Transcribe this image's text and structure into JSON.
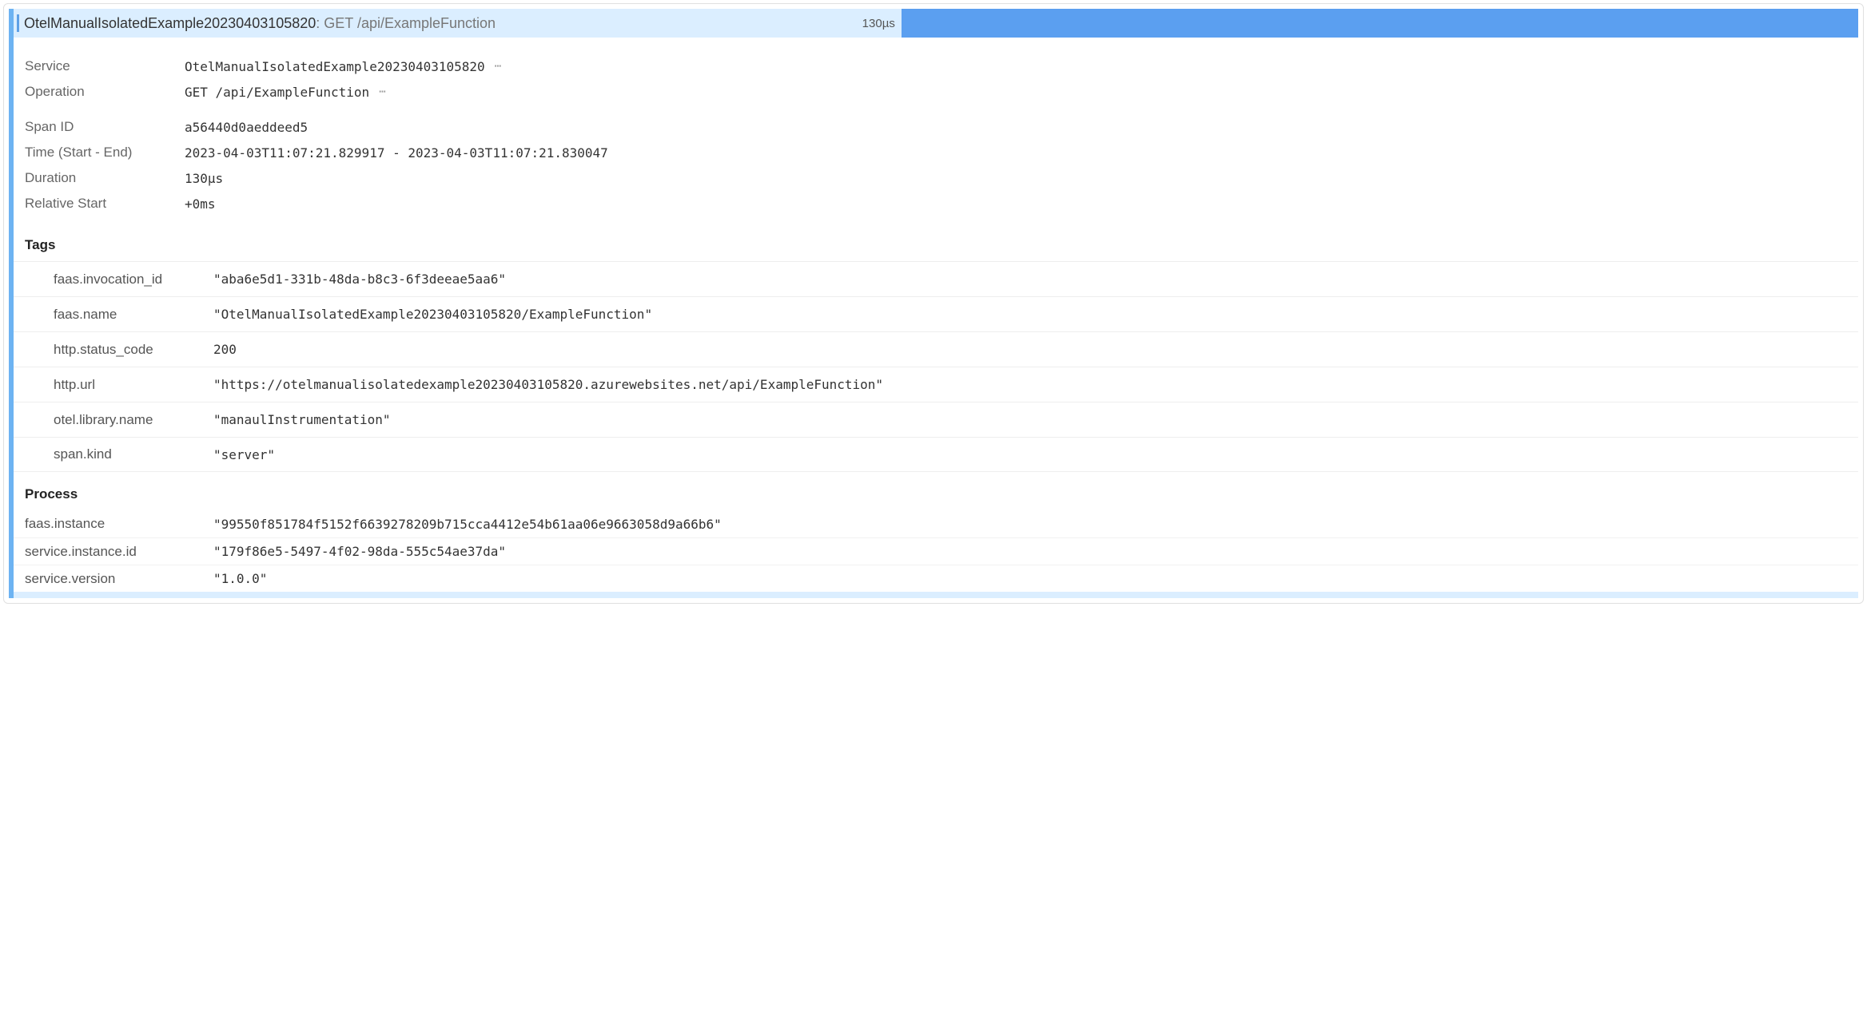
{
  "header": {
    "service": "OtelManualIsolatedExample20230403105820",
    "operation_sep": ": ",
    "operation": "GET /api/ExampleFunction",
    "duration": "130µs"
  },
  "overview": {
    "service_label": "Service",
    "service_value": "OtelManualIsolatedExample20230403105820",
    "operation_label": "Operation",
    "operation_value": "GET /api/ExampleFunction",
    "span_id_label": "Span ID",
    "span_id_value": "a56440d0aeddeed5",
    "time_label": "Time (Start - End)",
    "time_value": "2023-04-03T11:07:21.829917 - 2023-04-03T11:07:21.830047",
    "duration_label": "Duration",
    "duration_value": "130µs",
    "relstart_label": "Relative Start",
    "relstart_value": "+0ms"
  },
  "tags_title": "Tags",
  "tags": [
    {
      "key": "faas.invocation_id",
      "value": "\"aba6e5d1-331b-48da-b8c3-6f3deeae5aa6\""
    },
    {
      "key": "faas.name",
      "value": "\"OtelManualIsolatedExample20230403105820/ExampleFunction\""
    },
    {
      "key": "http.status_code",
      "value": "200"
    },
    {
      "key": "http.url",
      "value": "\"https://otelmanualisolatedexample20230403105820.azurewebsites.net/api/ExampleFunction\""
    },
    {
      "key": "otel.library.name",
      "value": "\"manaulInstrumentation\""
    },
    {
      "key": "span.kind",
      "value": "\"server\""
    }
  ],
  "process_title": "Process",
  "process": [
    {
      "key": "faas.instance",
      "value": "\"99550f851784f5152f6639278209b715cca4412e54b61aa06e9663058d9a66b6\""
    },
    {
      "key": "service.instance.id",
      "value": "\"179f86e5-5497-4f02-98da-555c54ae37da\""
    },
    {
      "key": "service.version",
      "value": "\"1.0.0\""
    }
  ]
}
